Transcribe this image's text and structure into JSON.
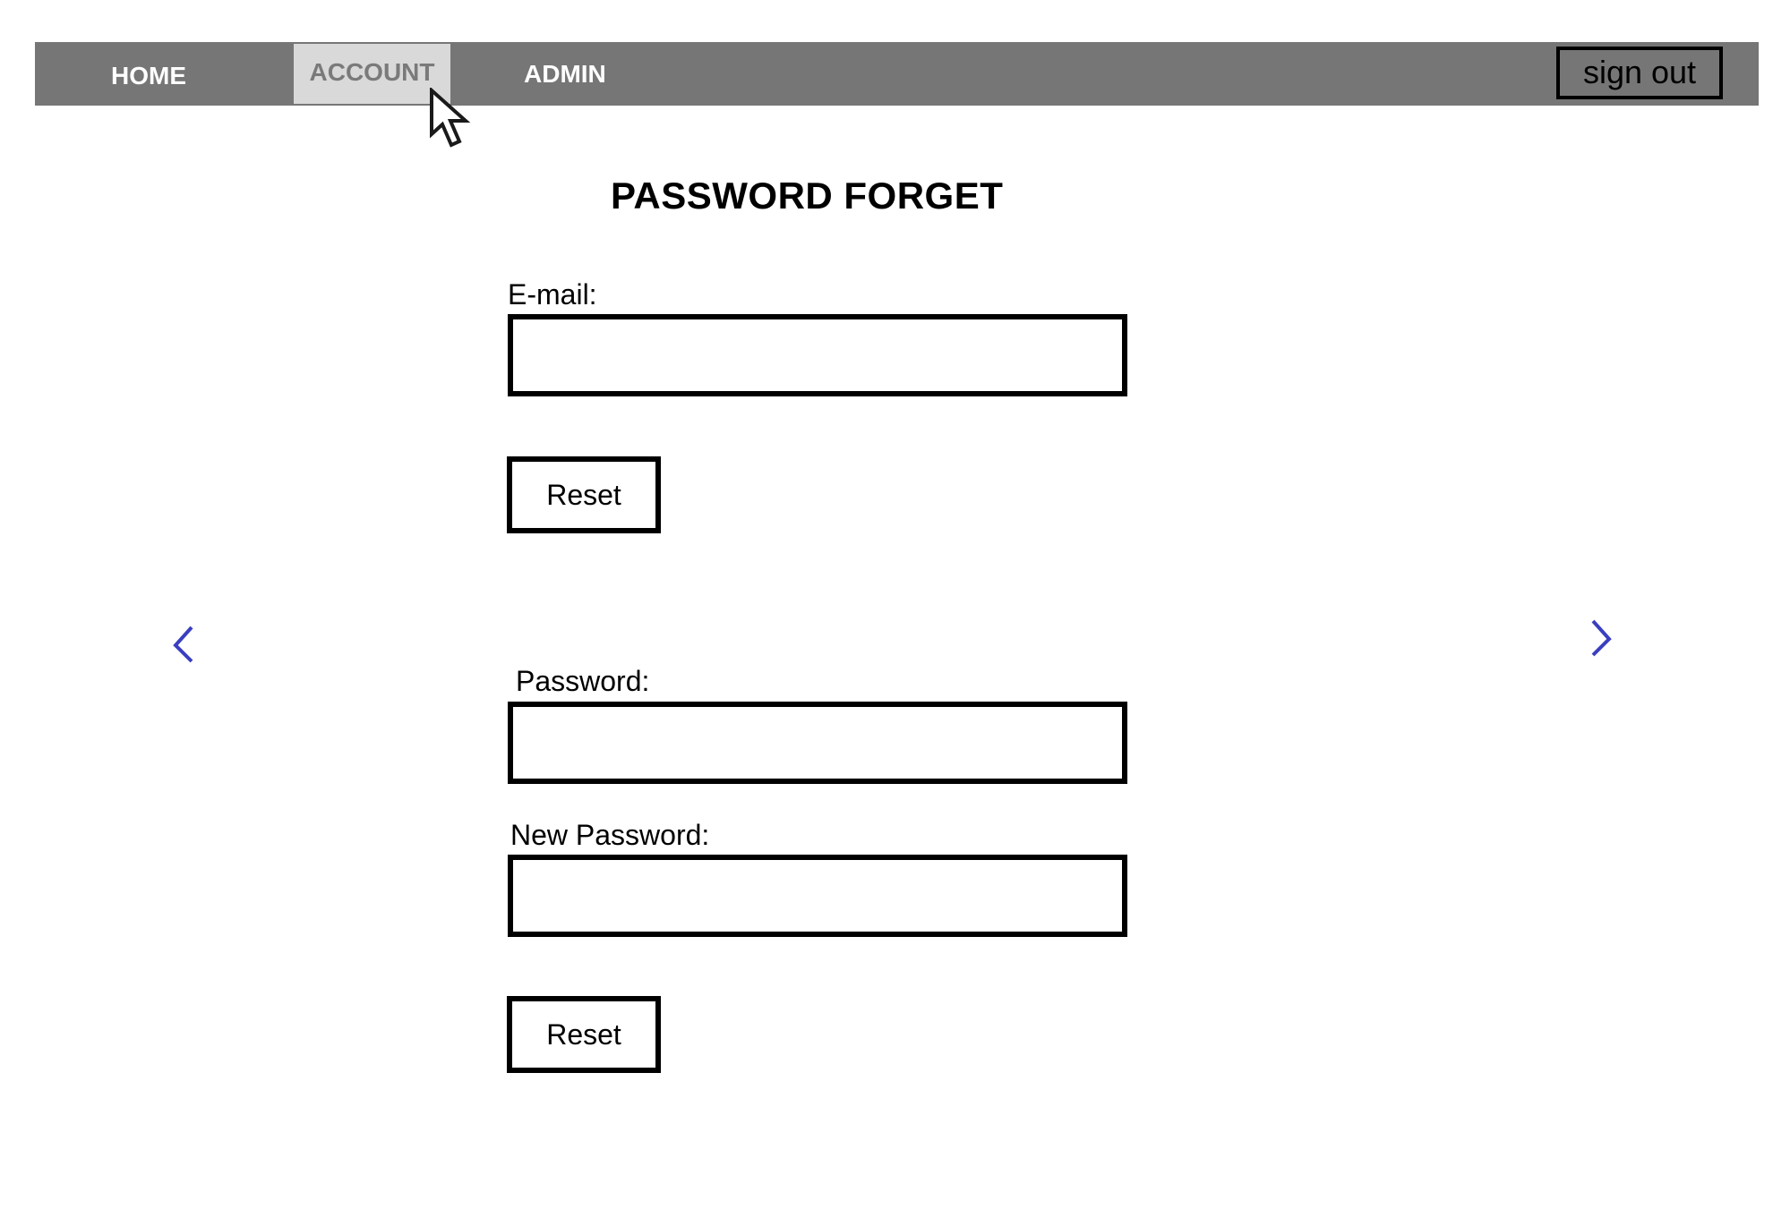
{
  "nav": {
    "items": [
      {
        "label": "HOME"
      },
      {
        "label": "ACCOUNT",
        "active": true
      },
      {
        "label": "ADMIN"
      }
    ],
    "signout_label": "sign out"
  },
  "page_title": "PASSWORD FORGET",
  "forget_form": {
    "email_label": "E-mail:",
    "email_value": "",
    "reset_label": "Reset"
  },
  "change_form": {
    "password_label": "Password:",
    "password_value": "",
    "new_password_label": "New Password:",
    "new_password_value": "",
    "reset_label": "Reset"
  },
  "icons": {
    "prev": "chevron-left-icon",
    "next": "chevron-right-icon",
    "cursor": "mouse-pointer-icon"
  },
  "colors": {
    "navbar_bg": "#767676",
    "active_tab_bg": "#d9d9d9",
    "arrow": "#3a3fbf"
  }
}
